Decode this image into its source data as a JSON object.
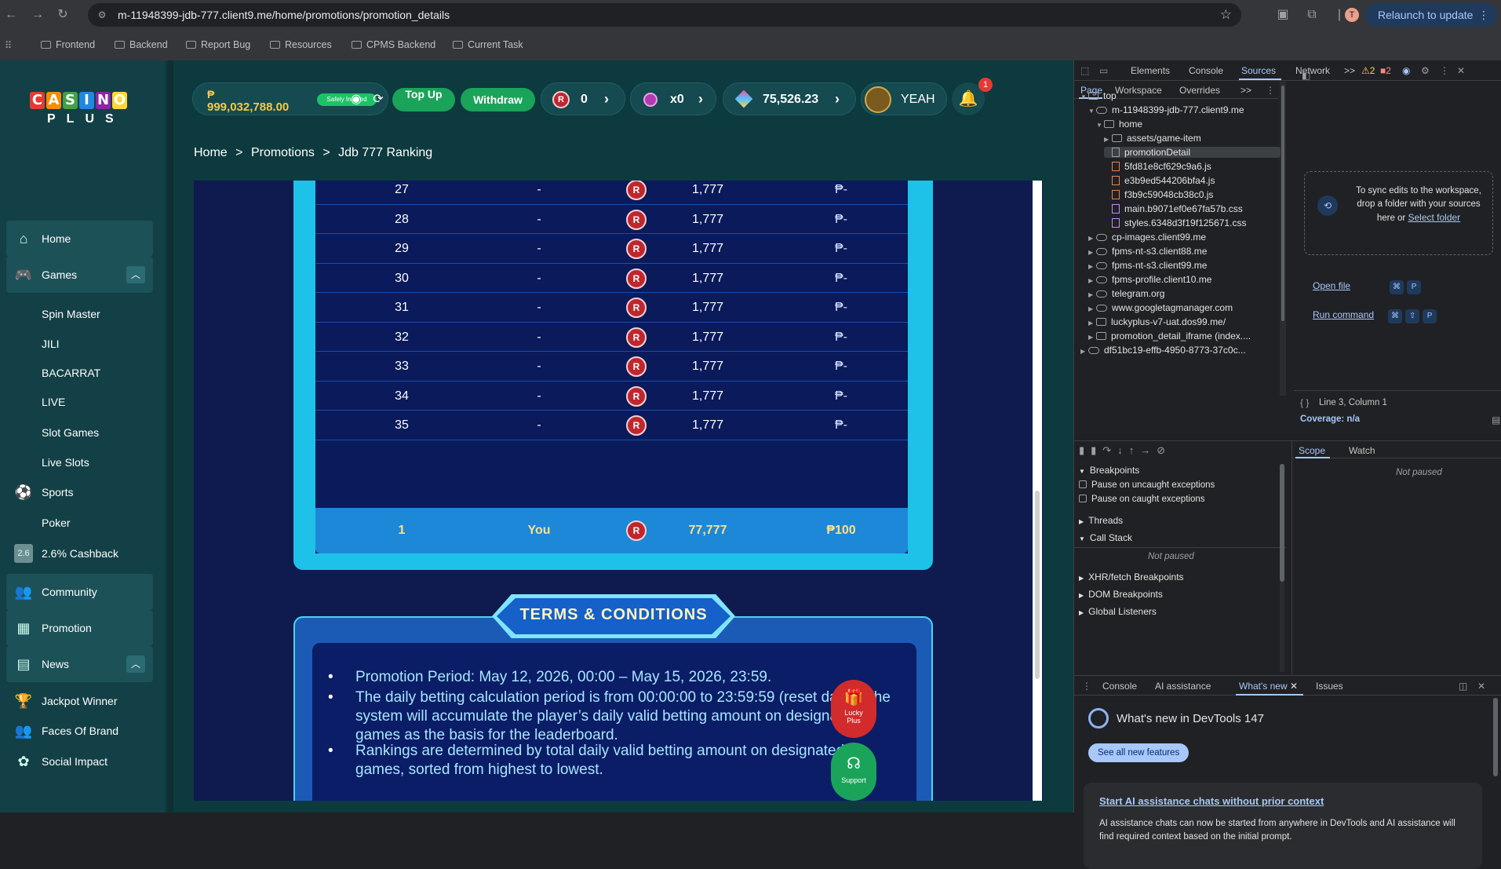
{
  "browser": {
    "url": "m-11948399-jdb-777.client9.me/home/promotions/promotion_details",
    "relaunch_label": "Relaunch to update",
    "profile_initial": "T",
    "bookmarks": [
      "Frontend",
      "Backend",
      "Report Bug",
      "Resources",
      "CPMS Backend",
      "Current Task"
    ]
  },
  "logo": {
    "top": [
      "C",
      "A",
      "S",
      "I",
      "N",
      "O"
    ],
    "bottom": "PLUS",
    "letter_colors": [
      "#e53935",
      "#fb8c00",
      "#43a047",
      "#1e88e5",
      "#8e24aa",
      "#fdd835"
    ]
  },
  "sidebar": {
    "items": [
      {
        "label": "Home",
        "icon": "home-icon",
        "type": "main"
      },
      {
        "label": "Games",
        "icon": "games-icon",
        "type": "main",
        "expandable": true
      },
      {
        "label": "Spin Master",
        "type": "sub"
      },
      {
        "label": "JILI",
        "type": "sub"
      },
      {
        "label": "BACARRAT",
        "type": "sub"
      },
      {
        "label": "LIVE",
        "type": "sub"
      },
      {
        "label": "Slot Games",
        "type": "sub"
      },
      {
        "label": "Live Slots",
        "type": "sub"
      },
      {
        "label": "Sports",
        "icon": "sports-icon",
        "type": "sub"
      },
      {
        "label": "Poker",
        "type": "sub"
      },
      {
        "label": "2.6% Cashback",
        "icon": "cashback-icon",
        "type": "sub"
      },
      {
        "label": "Community",
        "icon": "community-icon",
        "type": "main"
      },
      {
        "label": "Promotion",
        "icon": "promotion-icon",
        "type": "main"
      },
      {
        "label": "News",
        "icon": "news-icon",
        "type": "main",
        "expandable": true
      },
      {
        "label": "Jackpot Winner",
        "icon": "trophy-icon",
        "type": "sub"
      },
      {
        "label": "Faces Of Brand",
        "icon": "faces-icon",
        "type": "sub"
      },
      {
        "label": "Social Impact",
        "icon": "social-icon",
        "type": "sub"
      }
    ],
    "cashback_icon_text": "2.6"
  },
  "header": {
    "currency_symbol": "₱",
    "balance": "999,032,788.00",
    "safe_badge": "Safely Insured",
    "topup_label": "Top Up",
    "withdraw_label": "Withdraw",
    "rewards_count": "0",
    "multiplier": "x0",
    "gems": "75,526.23",
    "username": "YEAH",
    "notifications": "1"
  },
  "breadcrumb": [
    "Home",
    ">",
    "Promotions",
    ">",
    "Jdb 777 Ranking"
  ],
  "ranking": {
    "coin_icon": "R",
    "rows": [
      {
        "rank": "27",
        "player": "-",
        "points": "1,777",
        "prize": "₱-"
      },
      {
        "rank": "28",
        "player": "-",
        "points": "1,777",
        "prize": "₱-"
      },
      {
        "rank": "29",
        "player": "-",
        "points": "1,777",
        "prize": "₱-"
      },
      {
        "rank": "30",
        "player": "-",
        "points": "1,777",
        "prize": "₱-"
      },
      {
        "rank": "31",
        "player": "-",
        "points": "1,777",
        "prize": "₱-"
      },
      {
        "rank": "32",
        "player": "-",
        "points": "1,777",
        "prize": "₱-"
      },
      {
        "rank": "33",
        "player": "-",
        "points": "1,777",
        "prize": "₱-"
      },
      {
        "rank": "34",
        "player": "-",
        "points": "1,777",
        "prize": "₱-"
      },
      {
        "rank": "35",
        "player": "-",
        "points": "1,777",
        "prize": "₱-"
      }
    ],
    "you": {
      "rank": "1",
      "player": "You",
      "points": "77,777",
      "prize": "₱100"
    }
  },
  "terms": {
    "title": "TERMS & CONDITIONS",
    "items": [
      "Promotion Period: May 12, 2026, 00:00 – May 15, 2026, 23:59.",
      "The daily betting calculation period is from 00:00:00 to 23:59:59 (reset daily). The system will accumulate the player’s daily valid betting amount on designated games as the basis for the leaderboard.",
      "Rankings are determined by total daily valid betting amount on designated games, sorted from highest to lowest."
    ]
  },
  "floating": {
    "lucky": "Lucky Plus",
    "support": "Support"
  },
  "devtools": {
    "tabs": [
      "Elements",
      "Console",
      "Sources",
      "Network",
      ">>"
    ],
    "warnings": "2",
    "errors": "2",
    "subtabs": [
      "Page",
      "Workspace",
      "Overrides",
      ">>"
    ],
    "tree": [
      {
        "label": "top",
        "depth": 0,
        "kind": "frame",
        "open": true
      },
      {
        "label": "m-11948399-jdb-777.client9.me",
        "depth": 1,
        "kind": "cloud",
        "open": true
      },
      {
        "label": "home",
        "depth": 2,
        "kind": "folder",
        "open": true
      },
      {
        "label": "assets/game-item",
        "depth": 3,
        "kind": "folder",
        "open": false
      },
      {
        "label": "promotionDetail",
        "depth": 3,
        "kind": "doc",
        "selected": true
      },
      {
        "label": "5fd81e8cf629c9a6.js",
        "depth": 3,
        "kind": "js"
      },
      {
        "label": "e3b9ed544206bfa4.js",
        "depth": 3,
        "kind": "js"
      },
      {
        "label": "f3b9c59048cb38c0.js",
        "depth": 3,
        "kind": "js"
      },
      {
        "label": "main.b9071ef0e67fa57b.css",
        "depth": 3,
        "kind": "css"
      },
      {
        "label": "styles.6348d3f19f125671.css",
        "depth": 3,
        "kind": "css"
      },
      {
        "label": "cp-images.client99.me",
        "depth": 1,
        "kind": "cloud"
      },
      {
        "label": "fpms-nt-s3.client88.me",
        "depth": 1,
        "kind": "cloud"
      },
      {
        "label": "fpms-nt-s3.client99.me",
        "depth": 1,
        "kind": "cloud"
      },
      {
        "label": "fpms-profile.client10.me",
        "depth": 1,
        "kind": "cloud"
      },
      {
        "label": "telegram.org",
        "depth": 1,
        "kind": "cloud"
      },
      {
        "label": "www.googletagmanager.com",
        "depth": 1,
        "kind": "cloud"
      },
      {
        "label": "luckyplus-v7-uat.dos99.me/",
        "depth": 1,
        "kind": "frame"
      },
      {
        "label": "promotion_detail_iframe (index....",
        "depth": 1,
        "kind": "frame"
      },
      {
        "label": "df51bc19-effb-4950-8773-37c0c...",
        "depth": 0,
        "kind": "gear"
      }
    ],
    "sync_text": "To sync edits to the workspace, drop a folder with your sources here or",
    "select_folder": "Select folder",
    "open_file": "Open file",
    "run_command": "Run command",
    "cursor_pos": "Line 3, Column 1",
    "coverage": "Coverage: n/a",
    "scope_tabs": [
      "Scope",
      "Watch"
    ],
    "not_paused": "Not paused",
    "breakpoints_title": "Breakpoints",
    "pause_uncaught": "Pause on uncaught exceptions",
    "pause_caught": "Pause on caught exceptions",
    "threads": "Threads",
    "call_stack": "Call Stack",
    "call_not_paused": "Not paused",
    "xhr": "XHR/fetch Breakpoints",
    "dom": "DOM Breakpoints",
    "global": "Global Listeners",
    "drawer_tabs": [
      "Console",
      "AI assistance",
      "What's new",
      "Issues"
    ],
    "whats_new_title": "What's new in DevTools 147",
    "see_all": "See all new features",
    "ai_title": "Start AI assistance chats without prior context",
    "ai_text": "AI assistance chats can now be started from anywhere in DevTools and AI assistance will find required context based on the initial prompt."
  }
}
